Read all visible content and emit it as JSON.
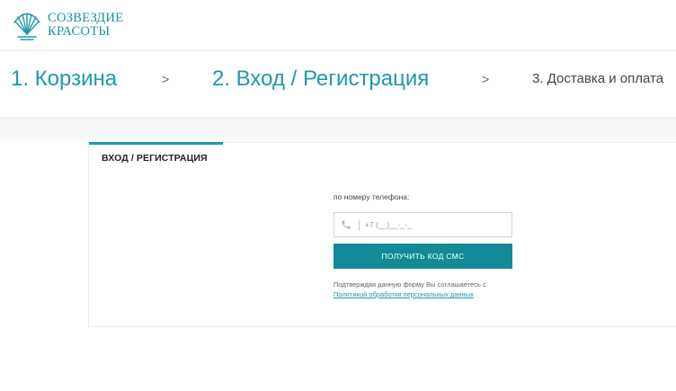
{
  "brand": {
    "line1": "СОЗВЕЗДИЕ",
    "line2": "КРАСОТЫ",
    "accent_color": "#1e9aa8",
    "icon": "shell-logo-icon"
  },
  "steps": [
    {
      "label": "1. Корзина"
    },
    {
      "label": "2. Вход / Регистрация"
    },
    {
      "label": "3. Доставка и оплата"
    }
  ],
  "step_separator": ">",
  "auth": {
    "tab_label": "ВХОД / РЕГИСТРАЦИЯ",
    "phone_label": "по номеру телефона:",
    "phone_value": "",
    "phone_placeholder": "+7 (__)__-_-_",
    "phone_icon": "phone-icon",
    "submit_label": "ПОЛУЧИТЬ КОД СМС",
    "button_color": "#138a97",
    "consent_text": "Подтверждая данную форму Вы соглашаетесь с",
    "consent_link": "Политикой обработки персональных данных"
  }
}
